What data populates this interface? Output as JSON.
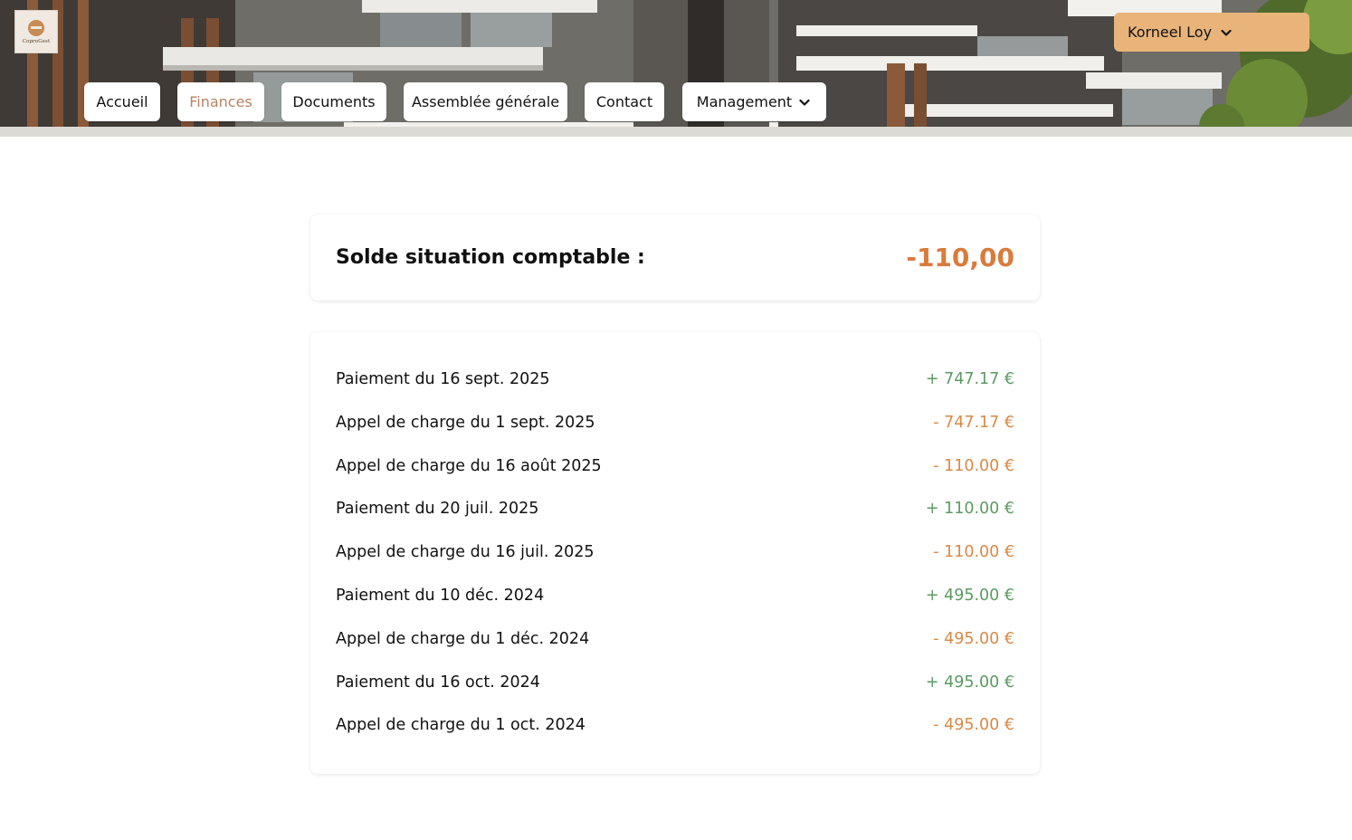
{
  "app": {
    "logo_text": "CoproGest",
    "user_name": "Korneel Loy"
  },
  "nav": {
    "items": [
      {
        "label": "Accueil",
        "active": false
      },
      {
        "label": "Finances",
        "active": true
      },
      {
        "label": "Documents",
        "active": false
      },
      {
        "label": "Assemblée générale",
        "active": false
      },
      {
        "label": "Contact",
        "active": false
      },
      {
        "label": "Management",
        "active": false,
        "dropdown": true
      }
    ]
  },
  "balance": {
    "label": "Solde situation comptable :",
    "value": "-110,00",
    "color": "#d97b3b"
  },
  "transactions": [
    {
      "label": "Paiement du 16 sept. 2025",
      "amount": "+ 747.17 €",
      "type": "credit"
    },
    {
      "label": "Appel de charge du 1 sept. 2025",
      "amount": "- 747.17 €",
      "type": "debit"
    },
    {
      "label": "Appel de charge du 16 août 2025",
      "amount": "- 110.00 €",
      "type": "debit"
    },
    {
      "label": "Paiement du 20 juil. 2025",
      "amount": "+ 110.00 €",
      "type": "credit"
    },
    {
      "label": "Appel de charge du 16 juil. 2025",
      "amount": "- 110.00 €",
      "type": "debit"
    },
    {
      "label": "Paiement du 10 déc. 2024",
      "amount": "+ 495.00 €",
      "type": "credit"
    },
    {
      "label": "Appel de charge du 1 déc. 2024",
      "amount": "- 495.00 €",
      "type": "debit"
    },
    {
      "label": "Paiement du 16 oct. 2024",
      "amount": "+ 495.00 €",
      "type": "credit"
    },
    {
      "label": "Appel de charge du 1 oct. 2024",
      "amount": "- 495.00 €",
      "type": "debit"
    }
  ],
  "colors": {
    "accent": "#e8b47a",
    "active_nav": "#b88462",
    "credit": "#5c9a62",
    "debit": "#d98945"
  },
  "icons": {
    "user_menu": "chevron-down-icon",
    "management_menu": "chevron-down-icon"
  }
}
